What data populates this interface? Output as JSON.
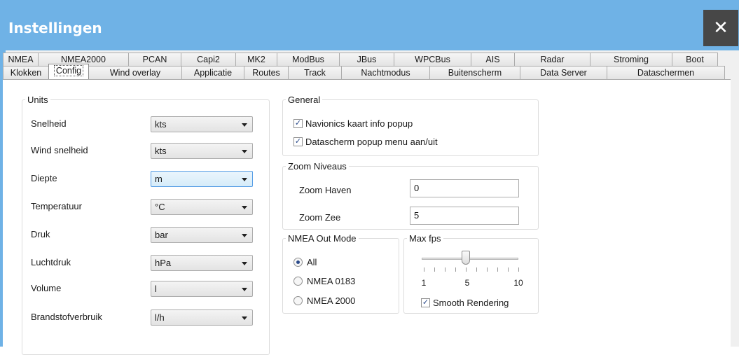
{
  "window": {
    "title": "Instellingen",
    "close_glyph": "✕"
  },
  "tabs": {
    "row1": [
      "NMEA",
      "NMEA2000",
      "PCAN",
      "Capi2",
      "MK2",
      "ModBus",
      "JBus",
      "WPCBus",
      "AIS",
      "Radar",
      "Stroming",
      "Boot"
    ],
    "row2": [
      "Klokken",
      "Config",
      "Wind overlay",
      "Applicatie",
      "Routes",
      "Track",
      "Nachtmodus",
      "Buitenscherm",
      "Data Server",
      "Dataschermen"
    ],
    "active": "Config"
  },
  "units": {
    "legend": "Units",
    "rows": [
      {
        "label": "Snelheid",
        "value": "kts"
      },
      {
        "label": "Wind snelheid",
        "value": "kts"
      },
      {
        "label": "Diepte",
        "value": "m"
      },
      {
        "label": "Temperatuur",
        "value": "°C"
      },
      {
        "label": "Druk",
        "value": "bar"
      },
      {
        "label": "Luchtdruk",
        "value": "hPa"
      },
      {
        "label": "Volume",
        "value": "l"
      },
      {
        "label": "Brandstofverbruik",
        "value": "l/h"
      }
    ]
  },
  "general": {
    "legend": "General",
    "navionics_label": "Navionics kaart info popup",
    "navionics_checked": true,
    "datascherm_label": "Datascherm popup menu aan/uit",
    "datascherm_checked": true,
    "check_glyph": "✓"
  },
  "zoom": {
    "legend": "Zoom Niveaus",
    "haven_label": "Zoom Haven",
    "haven_value": "0",
    "zee_label": "Zoom Zee",
    "zee_value": "5"
  },
  "nmea_out": {
    "legend": "NMEA Out Mode",
    "options": [
      "All",
      "NMEA 0183",
      "NMEA 2000"
    ],
    "selected": "All"
  },
  "max_fps": {
    "legend": "Max fps",
    "min_label": "1",
    "mid_label": "5",
    "max_label": "10",
    "value": 5,
    "min": 1,
    "max": 10,
    "smooth_label": "Smooth Rendering",
    "smooth_checked": true
  },
  "colors": {
    "titlebar": "#6fb2e6",
    "close_bg": "#474747",
    "focus": "#569de5"
  }
}
